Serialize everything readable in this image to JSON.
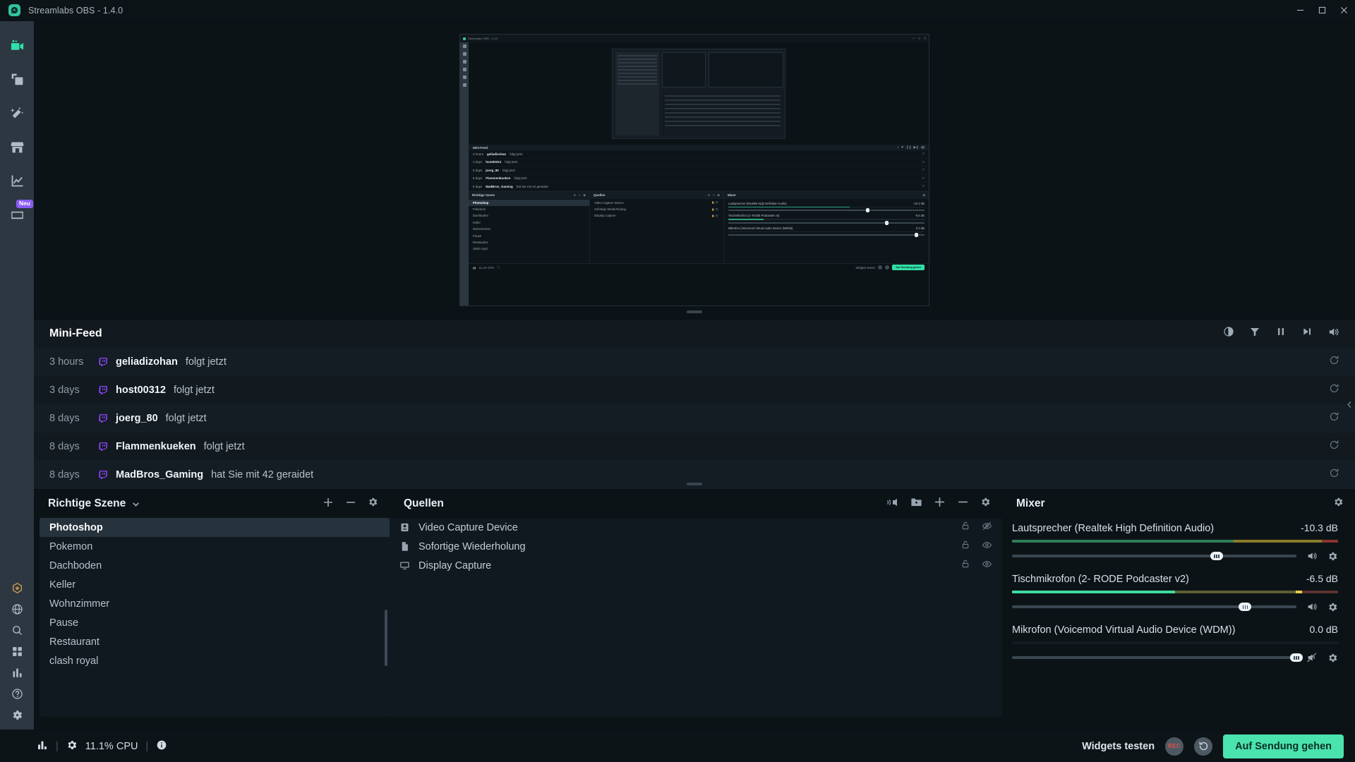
{
  "window": {
    "title": "Streamlabs OBS - 1.4.0",
    "logo_icon": "streamlabs-logo-icon",
    "minimize_icon": "minimize-icon",
    "maximize_icon": "maximize-icon",
    "close_icon": "close-icon"
  },
  "nav": {
    "items": [
      {
        "name": "editor",
        "icon": "video-camera-icon",
        "active": true,
        "badge": ""
      },
      {
        "name": "themes",
        "icon": "layers-icon",
        "active": false,
        "badge": ""
      },
      {
        "name": "effects",
        "icon": "magic-wand-icon",
        "active": false,
        "badge": ""
      },
      {
        "name": "store",
        "icon": "store-icon",
        "active": false,
        "badge": ""
      },
      {
        "name": "dashboard",
        "icon": "line-chart-icon",
        "active": false,
        "badge": ""
      },
      {
        "name": "highlighter",
        "icon": "clapperboard-icon",
        "active": false,
        "badge": "Neu"
      }
    ],
    "bottom_items": [
      {
        "name": "prime",
        "icon": "prime-star-icon"
      },
      {
        "name": "globe",
        "icon": "globe-icon"
      },
      {
        "name": "search",
        "icon": "search-icon"
      },
      {
        "name": "apps",
        "icon": "grid-apps-icon"
      },
      {
        "name": "stats",
        "icon": "bar-chart-icon"
      },
      {
        "name": "help",
        "icon": "help-circle-icon"
      },
      {
        "name": "settings",
        "icon": "gear-icon"
      }
    ]
  },
  "preview": {
    "nested_title": "Streamlabs OBS - 1.4.0",
    "feed_label": "Mini-Feed",
    "feed_rows": [
      {
        "time": "3 hours",
        "user": "geliadizohan",
        "action": "folgt jetzt"
      },
      {
        "time": "3 days",
        "user": "host00312",
        "action": "folgt jetzt"
      },
      {
        "time": "8 days",
        "user": "joerg_80",
        "action": "folgt jetzt"
      },
      {
        "time": "8 days",
        "user": "Flammenkueken",
        "action": "folgt jetzt"
      },
      {
        "time": "8 days",
        "user": "MadBros_Gaming",
        "action": "hat Sie mit 42 geraidet"
      }
    ],
    "scenes_label": "Richtige Szene",
    "scenes": [
      "Photoshop",
      "Pokemon",
      "Dachboden",
      "Keller",
      "Wohnzimmer",
      "Pause",
      "Restaurant",
      "clash royal"
    ],
    "sources_label": "Quellen",
    "sources": [
      "Video Capture Device",
      "Sofortige Wiederholung",
      "Display Capture"
    ],
    "mixer_label": "Mixer",
    "mixer": [
      {
        "label": "Lautsprecher (Realtek High Definition Audio)",
        "db": "-10.3 dB"
      },
      {
        "label": "Tischmikrofon (2- RODE Podcaster v2)",
        "db": "-6.5 dB"
      },
      {
        "label": "Mikrofon (Voicemod Virtual Audio Device (WDM))",
        "db": "0.0 dB"
      }
    ],
    "cpu": "11.1% CPU",
    "go_live": "Auf Sendung gehen",
    "widgets_test": "Widgets testen"
  },
  "minifeed": {
    "title": "Mini-Feed",
    "tools": [
      {
        "name": "contrast-toggle",
        "icon": "contrast-icon"
      },
      {
        "name": "filter",
        "icon": "filter-icon"
      },
      {
        "name": "pause",
        "icon": "pause-icon"
      },
      {
        "name": "skip",
        "icon": "skip-forward-icon"
      },
      {
        "name": "volume",
        "icon": "volume-icon"
      }
    ],
    "rows": [
      {
        "time": "3 hours",
        "platform": "twitch-icon",
        "user": "geliadizohan",
        "action": "folgt jetzt",
        "replay": "replay-icon"
      },
      {
        "time": "3 days",
        "platform": "twitch-icon",
        "user": "host00312",
        "action": "folgt jetzt",
        "replay": "replay-icon"
      },
      {
        "time": "8 days",
        "platform": "twitch-icon",
        "user": "joerg_80",
        "action": "folgt jetzt",
        "replay": "replay-icon"
      },
      {
        "time": "8 days",
        "platform": "twitch-icon",
        "user": "Flammenkueken",
        "action": "folgt jetzt",
        "replay": "replay-icon"
      },
      {
        "time": "8 days",
        "platform": "twitch-icon",
        "user": "MadBros_Gaming",
        "action": "hat Sie mit 42 geraidet",
        "replay": "replay-icon"
      }
    ]
  },
  "scenes_dock": {
    "title": "Richtige Szene",
    "dropdown_icon": "chevron-down-icon",
    "add_label": "+",
    "remove_label": "−",
    "settings_icon": "gear-icon",
    "items": [
      {
        "label": "Photoshop",
        "selected": true
      },
      {
        "label": "Pokemon",
        "selected": false
      },
      {
        "label": "Dachboden",
        "selected": false
      },
      {
        "label": "Keller",
        "selected": false
      },
      {
        "label": "Wohnzimmer",
        "selected": false
      },
      {
        "label": "Pause",
        "selected": false
      },
      {
        "label": "Restaurant",
        "selected": false
      },
      {
        "label": "clash royal",
        "selected": false
      }
    ]
  },
  "sources_dock": {
    "title": "Quellen",
    "tools": [
      {
        "name": "audio-source",
        "icon": "speaker-wave-icon"
      },
      {
        "name": "add-folder",
        "icon": "folder-plus-icon"
      },
      {
        "name": "add-source",
        "icon": "plus-icon"
      },
      {
        "name": "remove-source",
        "icon": "minus-icon"
      },
      {
        "name": "source-properties",
        "icon": "gear-icon"
      }
    ],
    "items": [
      {
        "label": "Video Capture Device",
        "icon": "camera-source-icon",
        "lock": "unlock-icon",
        "visibility": "eye-off-icon"
      },
      {
        "label": "Sofortige Wiederholung",
        "icon": "file-source-icon",
        "lock": "unlock-icon",
        "visibility": "eye-icon"
      },
      {
        "label": "Display Capture",
        "icon": "monitor-source-icon",
        "lock": "unlock-icon",
        "visibility": "eye-icon"
      }
    ]
  },
  "mixer_dock": {
    "title": "Mixer",
    "settings_icon": "gear-icon",
    "channels": [
      {
        "label": "Lautsprecher (Realtek High Definition Audio)",
        "db": "-10.3 dB",
        "meter_pct": 100,
        "meter_green_pct": 68,
        "meter_yellow_pct": 27,
        "meter_red_pct": 5,
        "fader_pct": 72,
        "mute_icon": "volume-on-icon",
        "settings_icon": "gear-icon"
      },
      {
        "label": "Tischmikrofon (2- RODE Podcaster v2)",
        "db": "-6.5 dB",
        "meter_pct": 100,
        "meter_green_pct": 50,
        "meter_yellow_pct": 37,
        "meter_red_pct": 13,
        "fader_pct": 82,
        "mute_icon": "volume-on-icon",
        "settings_icon": "gear-icon"
      },
      {
        "label": "Mikrofon (Voicemod Virtual Audio Device (WDM))",
        "db": "0.0 dB",
        "meter_pct": 0,
        "meter_green_pct": 0,
        "meter_yellow_pct": 0,
        "meter_red_pct": 0,
        "fader_pct": 100,
        "mute_icon": "volume-muted-icon",
        "settings_icon": "gear-icon"
      }
    ]
  },
  "footer": {
    "perf_icon": "bar-chart-icon",
    "gear_icon": "gear-icon",
    "cpu": "11.1% CPU",
    "info_icon": "info-icon",
    "separator": "|",
    "widgets_label": "Widgets testen",
    "rec_label": "REC",
    "replay_icon": "replay-buffer-icon",
    "go_live_label": "Auf Sendung gehen"
  },
  "colors": {
    "accent_green": "#31e0a8",
    "go_live": "#4ae3ae",
    "twitch_purple": "#9146ff",
    "badge_purple": "#8b5cf6",
    "prime_gold": "#c79a4a",
    "rec_red": "#e0504a",
    "panel_bg": "#101820",
    "nav_bg": "#2c3741",
    "selected_row": "#26323c"
  }
}
